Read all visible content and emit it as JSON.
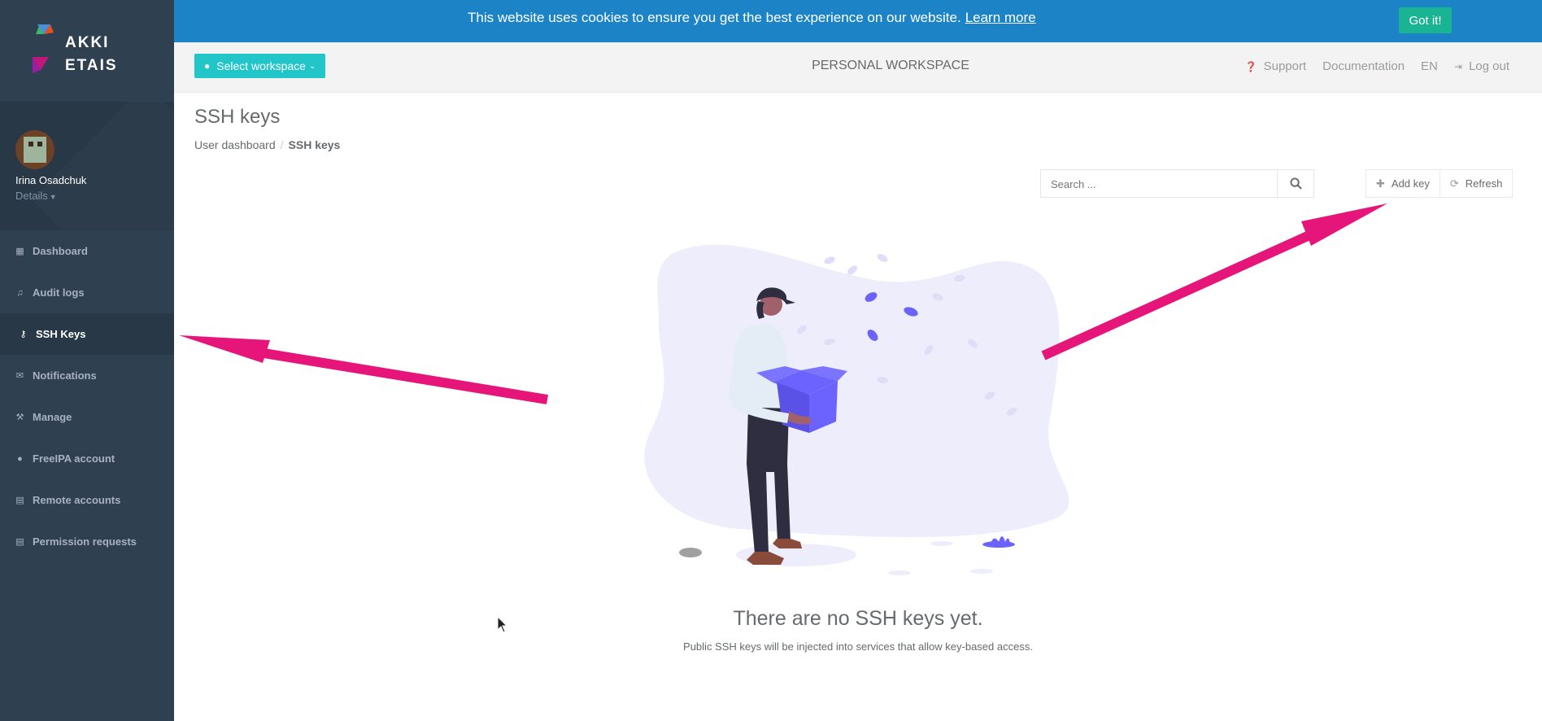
{
  "sidebar": {
    "logo_line1": "AKKI",
    "logo_line2": "ETAIS",
    "user_name": "Irina Osadchuk",
    "details_label": "Details",
    "items": [
      {
        "label": "Dashboard",
        "icon": "dashboard-icon"
      },
      {
        "label": "Audit logs",
        "icon": "bell-icon"
      },
      {
        "label": "SSH Keys",
        "icon": "key-icon",
        "active": true
      },
      {
        "label": "Notifications",
        "icon": "envelope-icon"
      },
      {
        "label": "Manage",
        "icon": "wrench-icon"
      },
      {
        "label": "FreeIPA account",
        "icon": "user-icon"
      },
      {
        "label": "Remote accounts",
        "icon": "file-icon"
      },
      {
        "label": "Permission requests",
        "icon": "file-icon"
      }
    ]
  },
  "cookie_bar": {
    "text": "This website uses cookies to ensure you get the best experience on our website.",
    "link": "Learn more",
    "button": "Got it!"
  },
  "topbar": {
    "workspace_button": "Select workspace",
    "workspace_title": "PERSONAL WORKSPACE",
    "support": "Support",
    "documentation": "Documentation",
    "language": "EN",
    "logout": "Log out"
  },
  "page": {
    "title": "SSH keys",
    "breadcrumb": [
      "User dashboard",
      "SSH keys"
    ]
  },
  "toolbar": {
    "search_placeholder": "Search ...",
    "add_key": "Add key",
    "refresh": "Refresh"
  },
  "empty_state": {
    "title": "There are no SSH keys yet.",
    "subtitle": "Public SSH keys will be injected into services that allow key-based access."
  },
  "colors": {
    "sidebar": "#2f4050",
    "cookie_bar": "#1c84c6",
    "got_it": "#1ab394",
    "workspace_button": "#23c6c8",
    "annotation_arrow": "#e6157a",
    "illustration_accent": "#6c63ff"
  }
}
